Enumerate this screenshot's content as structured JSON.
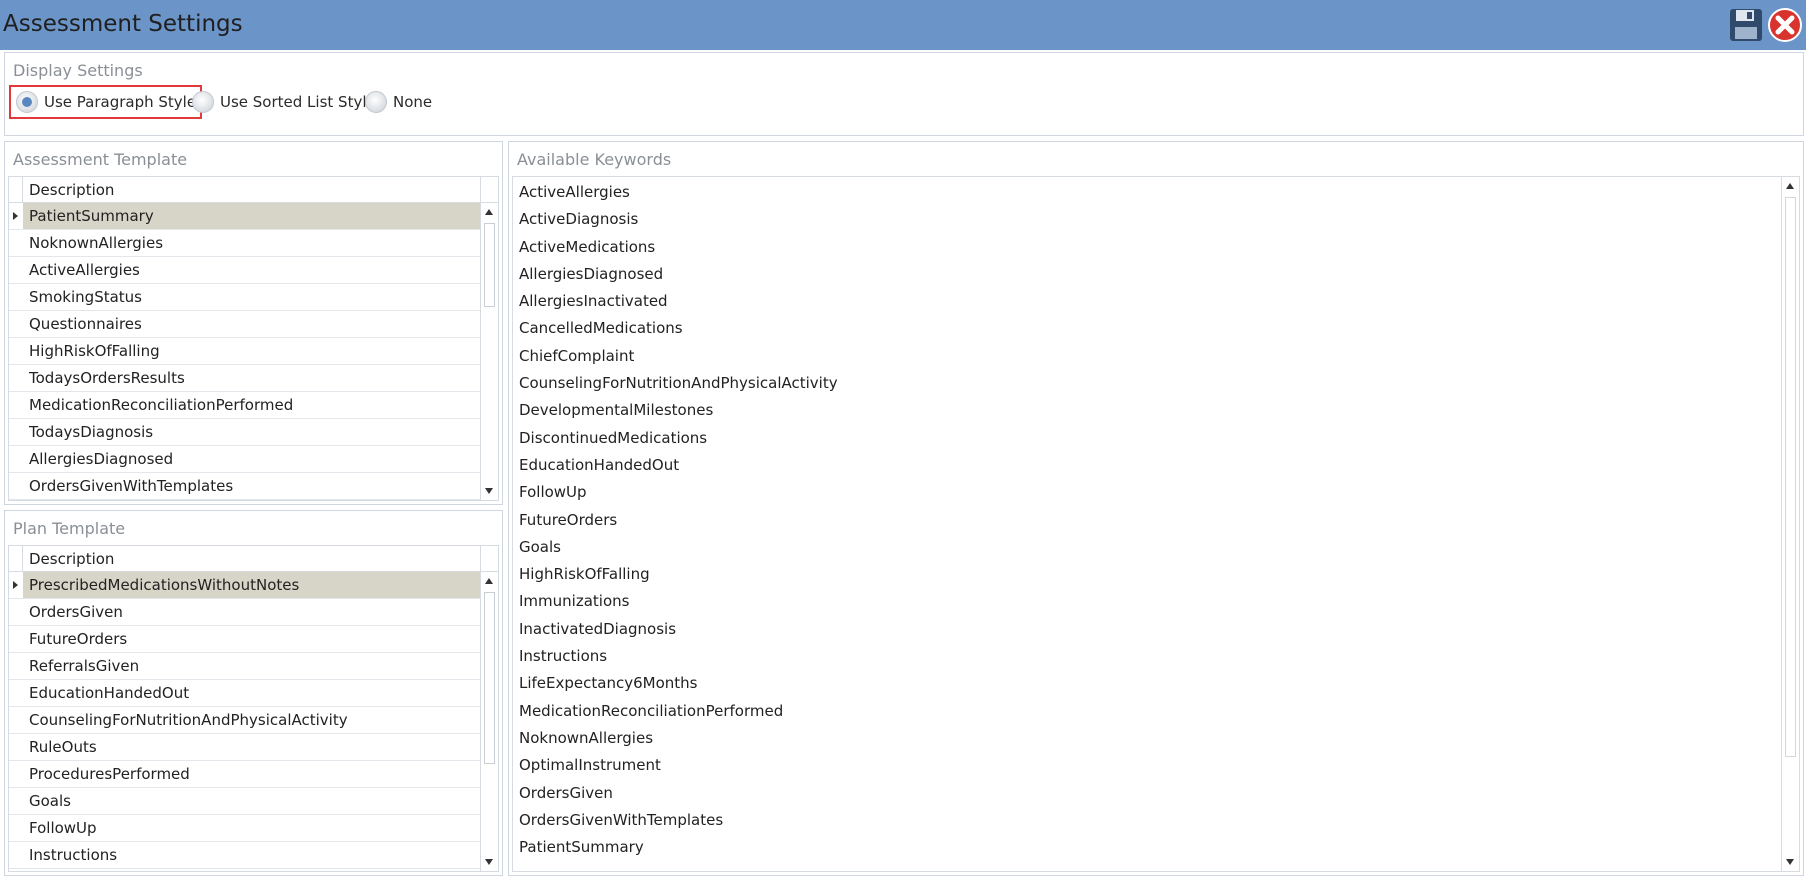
{
  "window": {
    "title": "Assessment Settings",
    "save_icon": "save-icon",
    "close_icon": "close-icon",
    "accent_color": "#6b94c8"
  },
  "display_settings": {
    "title": "Display Settings",
    "options": [
      {
        "label": "Use Paragraph Style",
        "checked": true
      },
      {
        "label": "Use Sorted List Style",
        "checked": false
      },
      {
        "label": "None",
        "checked": false
      }
    ]
  },
  "assessment_template": {
    "title": "Assessment Template",
    "column": "Description",
    "rows": [
      "PatientSummary",
      "NoknownAllergies",
      "ActiveAllergies",
      "SmokingStatus",
      "Questionnaires",
      "HighRiskOfFalling",
      "TodaysOrdersResults",
      "MedicationReconciliationPerformed",
      "TodaysDiagnosis",
      "AllergiesDiagnosed",
      "OrdersGivenWithTemplates"
    ]
  },
  "plan_template": {
    "title": "Plan Template",
    "column": "Description",
    "rows": [
      "PrescribedMedicationsWithoutNotes",
      "OrdersGiven",
      "FutureOrders",
      "ReferralsGiven",
      "EducationHandedOut",
      "CounselingForNutritionAndPhysicalActivity",
      "RuleOuts",
      "ProceduresPerformed",
      "Goals",
      "FollowUp",
      "Instructions"
    ]
  },
  "available_keywords": {
    "title": "Available Keywords",
    "items": [
      "ActiveAllergies",
      "ActiveDiagnosis",
      "ActiveMedications",
      "AllergiesDiagnosed",
      "AllergiesInactivated",
      "CancelledMedications",
      "ChiefComplaint",
      "CounselingForNutritionAndPhysicalActivity",
      "DevelopmentalMilestones",
      "DiscontinuedMedications",
      "EducationHandedOut",
      "FollowUp",
      "FutureOrders",
      "Goals",
      "HighRiskOfFalling",
      "Immunizations",
      "InactivatedDiagnosis",
      "Instructions",
      "LifeExpectancy6Months",
      "MedicationReconciliationPerformed",
      "NoknownAllergies",
      "OptimalInstrument",
      "OrdersGiven",
      "OrdersGivenWithTemplates",
      "PatientSummary"
    ]
  }
}
